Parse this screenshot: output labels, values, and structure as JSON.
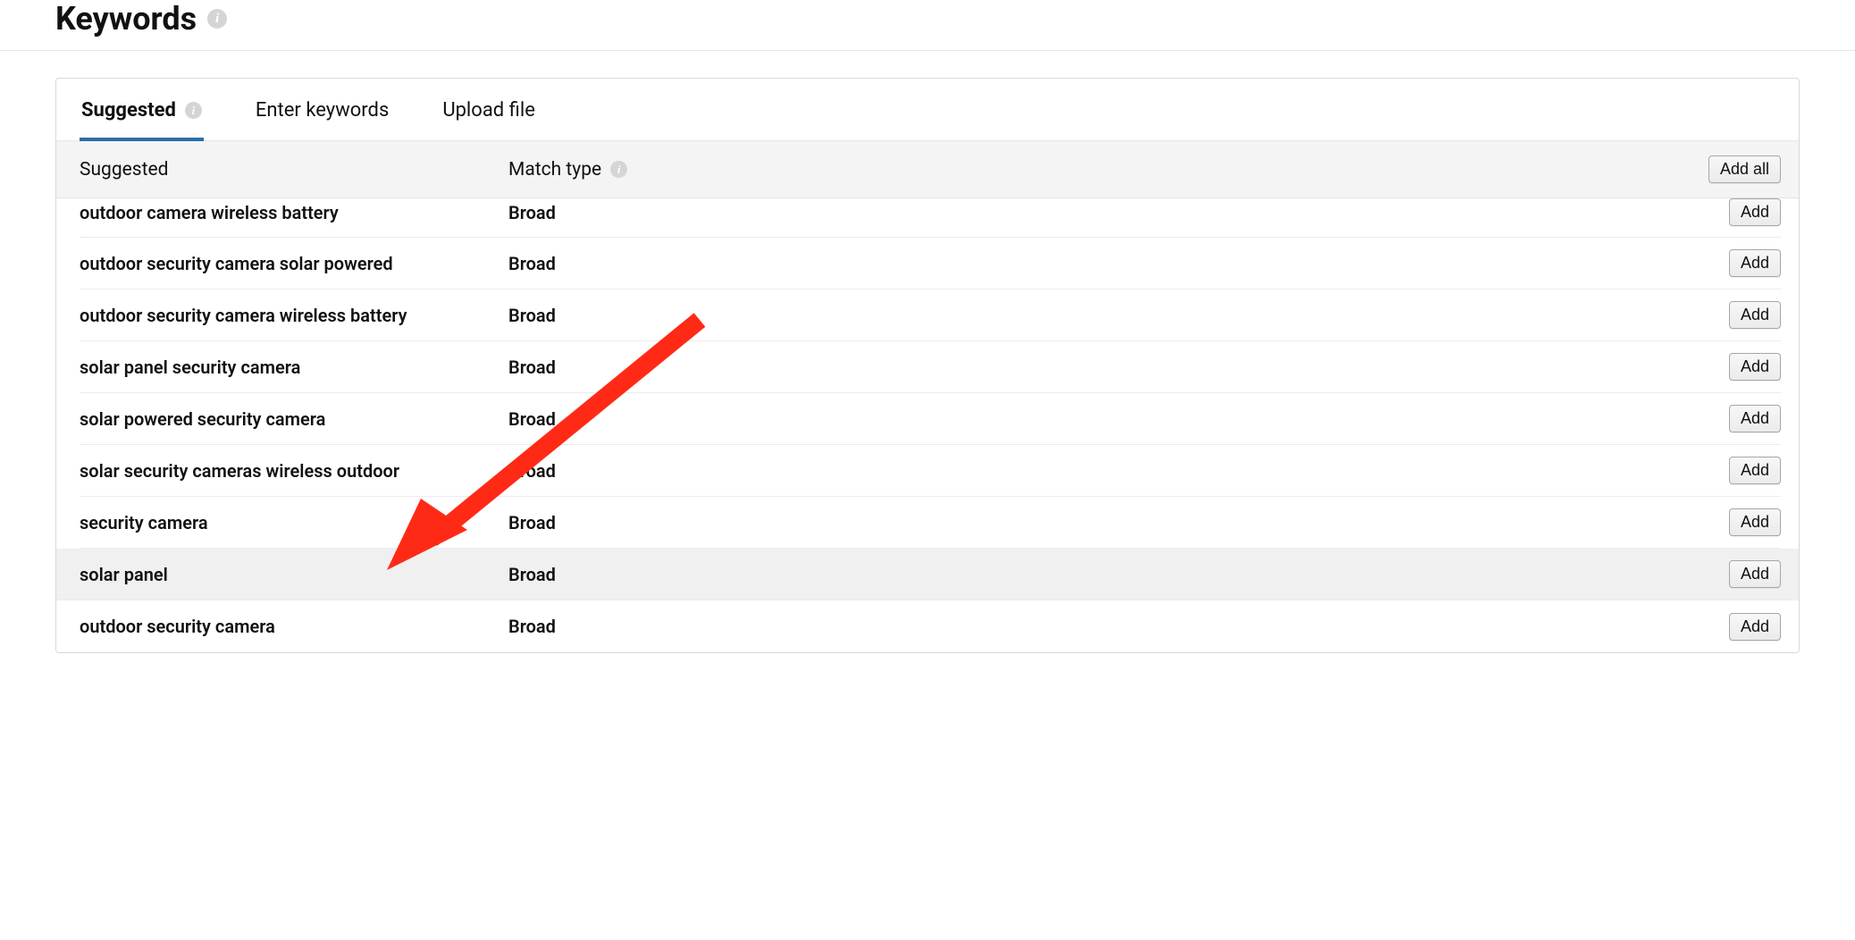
{
  "header": {
    "title": "Keywords"
  },
  "tabs": [
    {
      "label": "Suggested",
      "active": true,
      "hasInfo": true
    },
    {
      "label": "Enter keywords",
      "active": false,
      "hasInfo": false
    },
    {
      "label": "Upload file",
      "active": false,
      "hasInfo": false
    }
  ],
  "columns": {
    "keyword_header": "Suggested",
    "match_header": "Match type",
    "add_all_label": "Add all",
    "add_label": "Add"
  },
  "match_type_default": "Broad",
  "rows": [
    {
      "keyword": "outdoor camera wireless battery",
      "match": "Broad",
      "highlight": false
    },
    {
      "keyword": "outdoor security camera solar powered",
      "match": "Broad",
      "highlight": false
    },
    {
      "keyword": "outdoor security camera wireless battery",
      "match": "Broad",
      "highlight": false
    },
    {
      "keyword": "solar panel security camera",
      "match": "Broad",
      "highlight": false
    },
    {
      "keyword": "solar powered security camera",
      "match": "Broad",
      "highlight": false
    },
    {
      "keyword": "solar security cameras wireless outdoor",
      "match": "Broad",
      "highlight": false
    },
    {
      "keyword": "security camera",
      "match": "Broad",
      "highlight": false
    },
    {
      "keyword": "solar panel",
      "match": "Broad",
      "highlight": true
    },
    {
      "keyword": "outdoor security camera",
      "match": "Broad",
      "highlight": false
    }
  ],
  "annotation": {
    "type": "arrow",
    "color": "#ff2a16",
    "target_row_index": 7
  }
}
